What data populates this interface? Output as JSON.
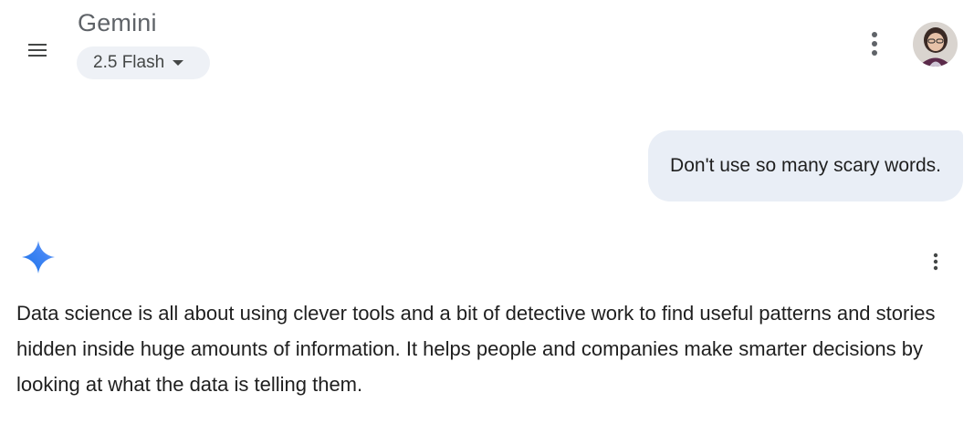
{
  "header": {
    "title": "Gemini",
    "model_selector": {
      "label": "2.5 Flash",
      "icon": "caret-down-icon"
    },
    "menu_icon": "hamburger-menu-icon",
    "more_icon": "more-vertical-icon",
    "avatar_icon": "user-avatar"
  },
  "conversation": {
    "user_message": "Don't use so many scary words.",
    "response": {
      "icon": "gemini-sparkle-icon",
      "more_icon": "more-vertical-icon",
      "text": "Data science is all about using clever tools and a bit of detective work to find useful patterns and stories hidden inside huge amounts of information. It helps people and companies make smarter decisions by looking at what the data is telling them."
    }
  },
  "colors": {
    "user_bubble_bg": "#e9eef6",
    "chip_bg": "#eef1f6",
    "sparkle_blue": "#4285f4",
    "text_primary": "#1f1f1f",
    "text_secondary": "#5f6368"
  }
}
